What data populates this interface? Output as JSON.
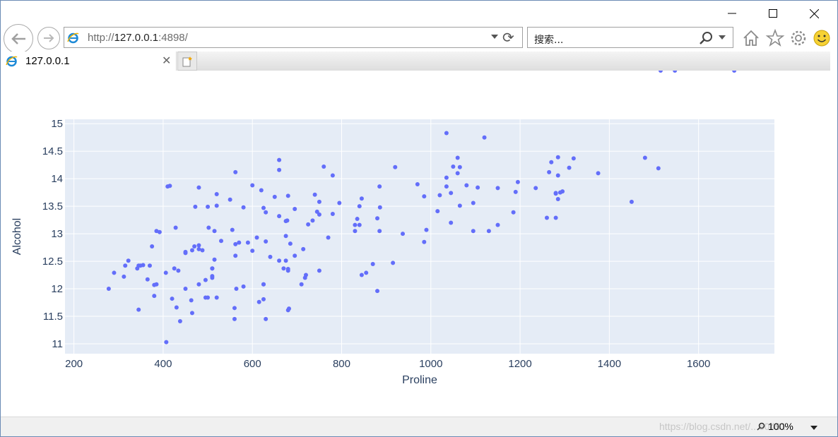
{
  "browser": {
    "address": {
      "scheme": "http://",
      "host": "127.0.0.1",
      "rest": ":4898/"
    },
    "search_placeholder": "搜索...",
    "tab_title": "127.0.0.1",
    "zoom_level": "100%",
    "watermark": "https://blog.csdn.net/...60491"
  },
  "colors": {
    "marker": "#636efa",
    "plot_bg": "#e5ecf6",
    "grid": "#ffffff",
    "axis_text": "#2a3f5f"
  },
  "chart_data": {
    "type": "scatter",
    "xlabel": "Proline",
    "ylabel": "Alcohol",
    "xlim": [
      180,
      1770
    ],
    "ylim": [
      10.82,
      15.08
    ],
    "xticks": [
      200,
      400,
      600,
      800,
      1000,
      1200,
      1400,
      1600
    ],
    "yticks": [
      11,
      11.5,
      12,
      12.5,
      13,
      13.5,
      14,
      14.5,
      15
    ],
    "ytick_labels": [
      "11",
      "11.5",
      "12",
      "12.5",
      "13",
      "13.5",
      "14",
      "14.5",
      "15"
    ],
    "x": [
      278,
      290,
      312,
      315,
      322,
      342,
      345,
      345,
      349,
      355,
      365,
      370,
      375,
      380,
      380,
      385,
      385,
      392,
      406,
      407,
      410,
      415,
      420,
      425,
      428,
      430,
      434,
      438,
      450,
      450,
      450,
      463,
      465,
      465,
      470,
      472,
      480,
      480,
      480,
      480,
      488,
      495,
      495,
      500,
      500,
      502,
      510,
      510,
      510,
      510,
      515,
      515,
      520,
      520,
      520,
      530,
      550,
      555,
      560,
      560,
      562,
      562,
      562,
      564,
      570,
      580,
      580,
      590,
      600,
      600,
      610,
      615,
      620,
      625,
      625,
      625,
      625,
      630,
      630,
      630,
      640,
      650,
      660,
      660,
      660,
      660,
      670,
      675,
      675,
      675,
      678,
      680,
      680,
      680,
      680,
      682,
      685,
      695,
      695,
      710,
      714,
      718,
      720,
      725,
      735,
      740,
      745,
      750,
      750,
      750,
      760,
      770,
      780,
      780,
      795,
      830,
      830,
      835,
      840,
      840,
      845,
      845,
      855,
      870,
      880,
      880,
      885,
      885,
      886,
      915,
      920,
      937,
      970,
      985,
      985,
      990,
      1015,
      1020,
      1035,
      1035,
      1035,
      1045,
      1045,
      1050,
      1060,
      1060,
      1065,
      1065,
      1080,
      1095,
      1095,
      1105,
      1120,
      1130,
      1150,
      1150,
      1185,
      1190,
      1195,
      1235,
      1260,
      1265,
      1270,
      1280,
      1280,
      1280,
      1285,
      1285,
      1285,
      1290,
      1295,
      1310,
      1320,
      1375,
      1450,
      1480,
      1510,
      1515,
      1547,
      1680
    ],
    "y": [
      12.0,
      12.29,
      12.22,
      12.42,
      12.51,
      12.37,
      11.62,
      12.42,
      12.42,
      12.43,
      12.17,
      12.42,
      12.77,
      12.07,
      11.87,
      12.08,
      13.05,
      13.03,
      12.29,
      11.03,
      13.86,
      13.87,
      11.82,
      12.37,
      13.11,
      11.66,
      12.33,
      11.41,
      12.65,
      12.67,
      12.0,
      11.79,
      12.7,
      11.56,
      12.77,
      13.49,
      12.08,
      12.79,
      13.84,
      12.72,
      12.7,
      12.16,
      11.84,
      13.49,
      11.84,
      13.11,
      12.23,
      12.37,
      12.2,
      12.37,
      12.53,
      13.05,
      13.72,
      11.84,
      13.51,
      12.87,
      13.62,
      13.07,
      11.45,
      11.65,
      12.6,
      12.81,
      14.12,
      12.0,
      12.84,
      12.04,
      13.48,
      12.84,
      13.88,
      12.69,
      12.93,
      11.76,
      13.79,
      13.47,
      11.81,
      12.08,
      12.08,
      11.45,
      12.86,
      13.39,
      12.58,
      13.67,
      13.32,
      12.51,
      14.34,
      14.16,
      12.37,
      12.96,
      12.51,
      13.23,
      13.24,
      12.33,
      13.69,
      12.36,
      11.61,
      11.64,
      12.82,
      12.6,
      13.45,
      12.08,
      12.72,
      12.2,
      12.25,
      13.17,
      13.24,
      13.71,
      13.4,
      13.35,
      13.58,
      12.33,
      14.22,
      12.93,
      13.36,
      14.06,
      13.56,
      13.05,
      13.16,
      13.27,
      13.16,
      13.5,
      13.64,
      12.25,
      12.29,
      12.45,
      13.28,
      11.96,
      13.05,
      13.86,
      13.48,
      12.47,
      14.21,
      13.0,
      13.9,
      13.68,
      12.85,
      13.07,
      13.41,
      13.7,
      14.02,
      14.83,
      13.86,
      13.2,
      13.74,
      14.22,
      14.1,
      14.38,
      14.21,
      13.51,
      13.88,
      13.05,
      13.56,
      13.84,
      14.75,
      13.05,
      13.16,
      13.83,
      13.39,
      13.76,
      13.94,
      13.83,
      13.29,
      14.12,
      14.3,
      13.29,
      13.74,
      13.73,
      14.39,
      14.06,
      13.63,
      13.75,
      13.77,
      14.2,
      14.37,
      14.1,
      13.58,
      14.38,
      14.19
    ]
  }
}
